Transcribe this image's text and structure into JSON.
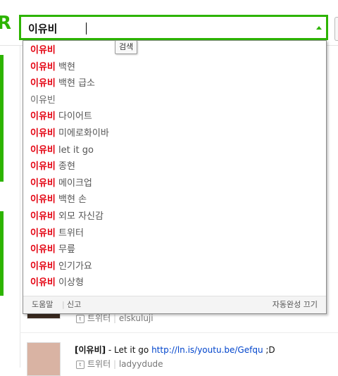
{
  "search": {
    "value": "이유비"
  },
  "tooltip": "검색",
  "suggestions": [
    {
      "match": "이유비",
      "rest": ""
    },
    {
      "match": "이유비",
      "rest": " 백현"
    },
    {
      "match": "이유비",
      "rest": " 백현 급소"
    },
    {
      "match": "",
      "rest": "이유빈"
    },
    {
      "match": "이유비",
      "rest": " 다이어트"
    },
    {
      "match": "이유비",
      "rest": " 미에로화이바"
    },
    {
      "match": "이유비",
      "rest": " let it go"
    },
    {
      "match": "이유비",
      "rest": " 종현"
    },
    {
      "match": "이유비",
      "rest": " 메이크업"
    },
    {
      "match": "이유비",
      "rest": " 백현 손"
    },
    {
      "match": "이유비",
      "rest": " 외모 자신감"
    },
    {
      "match": "이유비",
      "rest": " 트위터"
    },
    {
      "match": "이유비",
      "rest": " 무릎"
    },
    {
      "match": "이유비",
      "rest": " 인기가요"
    },
    {
      "match": "이유비",
      "rest": " 이상형"
    }
  ],
  "footer": {
    "help": "도움말",
    "separator": "|",
    "report": "신고",
    "turn_off": "자동완성 끄기"
  },
  "feed": {
    "item1": {
      "source": "트위터",
      "user": "elskuluji"
    },
    "item2": {
      "tag": "[이유비]",
      "text": " - Let it go ",
      "link": "http://ln.is/youtu.be/Gefqu",
      "suffix": " ;D",
      "source": "트위터",
      "user": "ladyydude"
    }
  },
  "colors": {
    "accent": "#2db400",
    "match": "#e4000f",
    "link": "#0044cc"
  }
}
